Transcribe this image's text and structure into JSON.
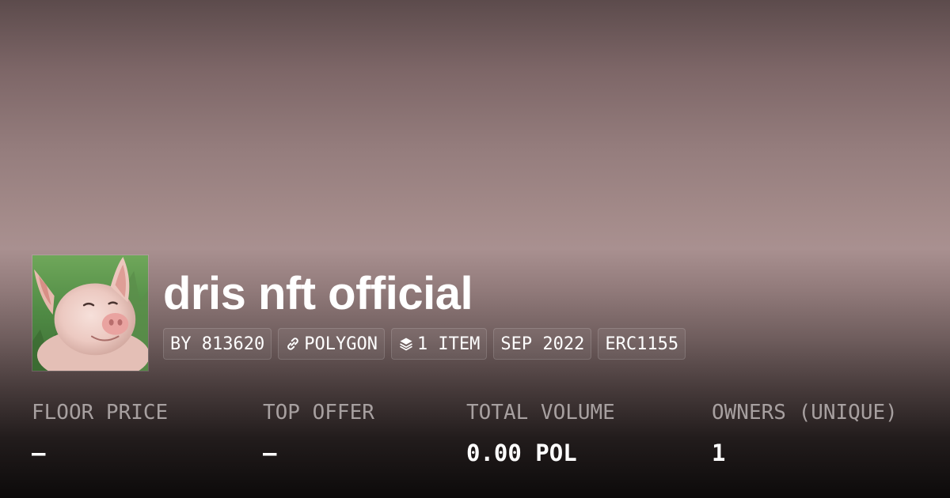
{
  "collection": {
    "name": "dris nft official",
    "avatar_icon": "pig-avatar-icon"
  },
  "badges": {
    "creator": "BY 813620",
    "chain": "POLYGON",
    "chain_icon": "link-icon",
    "items": "1 ITEM",
    "items_icon": "layers-icon",
    "date": "SEP 2022",
    "standard": "ERC1155"
  },
  "stats": {
    "floor_price": {
      "label": "FLOOR PRICE",
      "value": "–"
    },
    "top_offer": {
      "label": "TOP OFFER",
      "value": "–"
    },
    "total_volume": {
      "label": "TOTAL VOLUME",
      "value": "0.00 POL"
    },
    "owners": {
      "label": "OWNERS (UNIQUE)",
      "value": "1"
    }
  },
  "colors": {
    "text_primary": "#ffffff",
    "text_muted": "#a7a0a0",
    "bg_top": "#5c4b4c",
    "bg_mid": "#a99090",
    "bg_bottom": "#0c0a0a"
  }
}
